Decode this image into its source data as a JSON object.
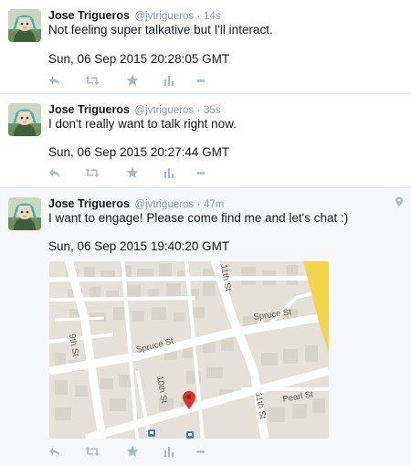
{
  "tweets": [
    {
      "name": "Jose Trigueros",
      "handle": "@jvtrigueros",
      "sep": "·",
      "time": "14s",
      "text": "Not feeling super talkative but I'll interact.",
      "date": "Sun, 06 Sep 2015 20:28:05 GMT"
    },
    {
      "name": "Jose Trigueros",
      "handle": "@jvtrigueros",
      "sep": "·",
      "time": "35s",
      "text": "I don't really want to talk right now.",
      "date": "Sun, 06 Sep 2015 20:27:44 GMT"
    },
    {
      "name": "Jose Trigueros",
      "handle": "@jvtrigueros",
      "sep": "·",
      "time": "47m",
      "text": "I want to engage! Please come find me and let's chat :)",
      "date": "Sun, 06 Sep 2015 19:40:20 GMT",
      "has_location": true
    }
  ],
  "map": {
    "streets": {
      "eleventh_top": "11th St",
      "spruce_right": "Spruce St",
      "ninth": "9th St",
      "spruce_left": "Spruce St",
      "tenth": "10th St",
      "eleventh_bottom": "11th St",
      "pearl": "Pearl St"
    },
    "colors": {
      "land": "#e5e0d8",
      "road": "#ffffff",
      "building": "#d9d4cb",
      "highway": "#f2d34a",
      "pin": "#d9322c",
      "transit": "#3b7ec5"
    }
  },
  "actions": {
    "icons": [
      "reply-icon",
      "retweet-icon",
      "favorite-icon",
      "analytics-icon",
      "more-icon"
    ],
    "more_glyph": "•••"
  },
  "colors": {
    "text": "#14171a",
    "muted": "#8899a6",
    "action": "#aab8c2",
    "geo_background": "#f5f8fa",
    "border": "#e6ecf0"
  }
}
